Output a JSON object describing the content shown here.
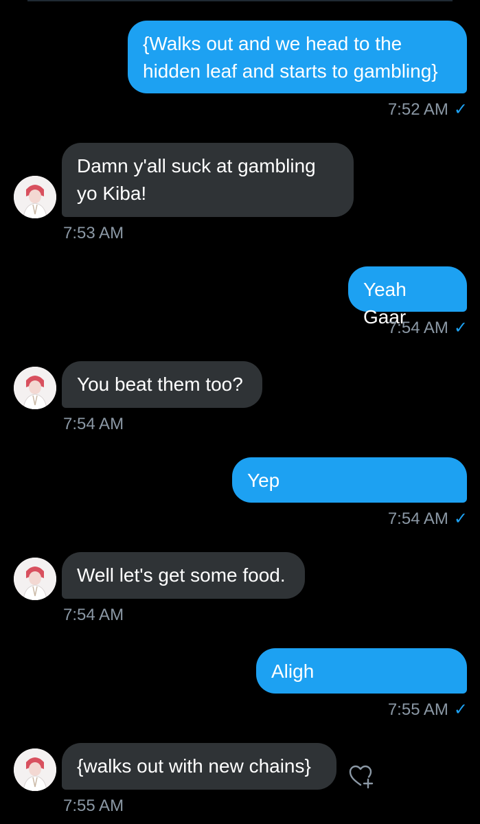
{
  "colors": {
    "background": "#000000",
    "sent_bubble": "#1da1f2",
    "received_bubble": "#2f3336",
    "timestamp": "#8b98a5",
    "check": "#1da1f2"
  },
  "messages": [
    {
      "direction": "sent",
      "text": "{Walks out and we head to the\nhidden leaf and starts to gambling}",
      "time": "7:52 AM",
      "status_icon": "check-icon"
    },
    {
      "direction": "received",
      "text": "Damn y'all suck at gambling\nyo Kiba!",
      "time": "7:53 AM",
      "avatar_icon": "avatar-icon"
    },
    {
      "direction": "sent",
      "text": "Yeah Gaar",
      "time": "7:54 AM",
      "status_icon": "check-icon"
    },
    {
      "direction": "received",
      "text": "You beat them too?",
      "time": "7:54 AM",
      "avatar_icon": "avatar-icon"
    },
    {
      "direction": "sent",
      "text": "Yep",
      "time": "7:54 AM",
      "status_icon": "check-icon"
    },
    {
      "direction": "received",
      "text": "Well let's get some food.",
      "time": "7:54 AM",
      "avatar_icon": "avatar-icon"
    },
    {
      "direction": "sent",
      "text": "Aligh",
      "time": "7:55 AM",
      "status_icon": "check-icon"
    },
    {
      "direction": "received",
      "text": "{walks out with new chains}",
      "time": "7:55 AM",
      "avatar_icon": "avatar-icon",
      "reaction_icon": "add-reaction-heart-icon"
    }
  ],
  "check_glyph": "✓"
}
